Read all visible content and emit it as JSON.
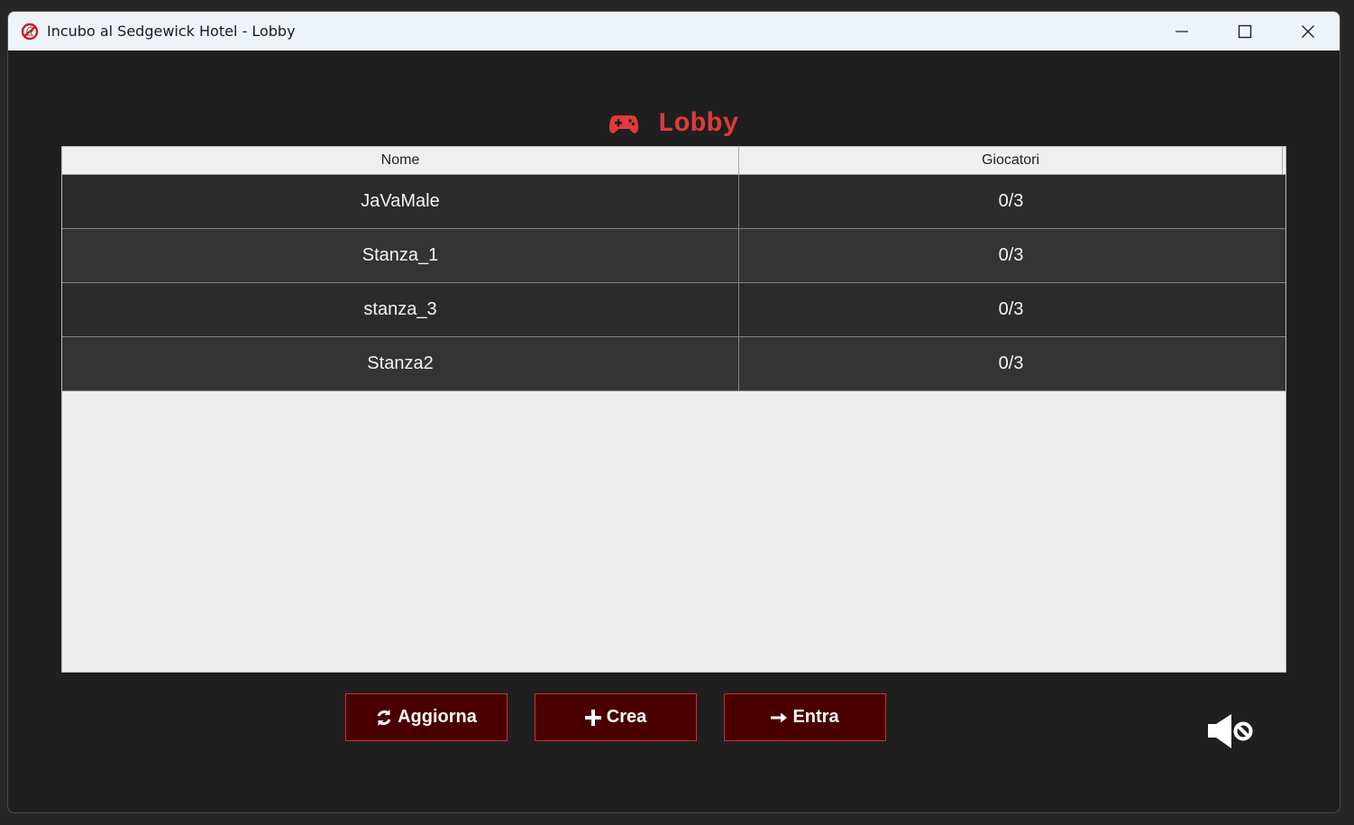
{
  "window": {
    "title": "Incubo al Sedgewick Hotel - Lobby",
    "controls": [
      "minimize",
      "maximize",
      "close"
    ]
  },
  "heading": {
    "icon": "gamepad-icon",
    "title": "Lobby",
    "color": "#e03a3a"
  },
  "table": {
    "columns": [
      "Nome",
      "Giocatori"
    ],
    "rows": [
      {
        "name": "JaVaMale",
        "players": "0/3"
      },
      {
        "name": "Stanza_1",
        "players": "0/3"
      },
      {
        "name": "stanza_3",
        "players": "0/3"
      },
      {
        "name": "Stanza2",
        "players": "0/3"
      }
    ]
  },
  "actions": {
    "refresh_label": "Aggiorna",
    "create_label": "Crea",
    "join_label": "Entra"
  },
  "audio": {
    "icon": "volume-muted-icon"
  },
  "colors": {
    "background": "#1f1f1f",
    "button_bg": "#4a0000",
    "button_border": "#d42a2a"
  }
}
